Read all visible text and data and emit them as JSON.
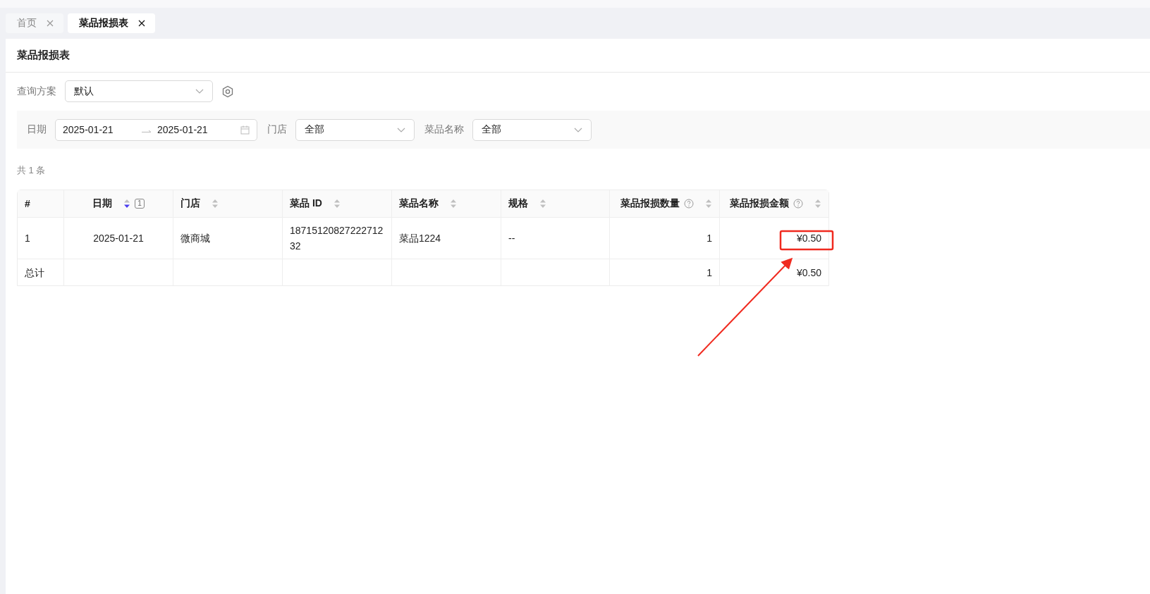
{
  "tabs": [
    {
      "label": "首页",
      "selected": false
    },
    {
      "label": "菜品报损表",
      "selected": true
    }
  ],
  "page": {
    "title": "菜品报损表"
  },
  "query_scheme": {
    "label": "查询方案",
    "value": "默认"
  },
  "filters": {
    "date": {
      "label": "日期",
      "start": "2025-01-21",
      "end": "2025-01-21"
    },
    "store": {
      "label": "门店",
      "value": "全部"
    },
    "dish_name": {
      "label": "菜品名称",
      "value": "全部"
    }
  },
  "total_count": "共 1 条",
  "table": {
    "columns": [
      {
        "label": "#",
        "kind": "index",
        "sortable": false,
        "help": false
      },
      {
        "label": "日期",
        "kind": "date",
        "sortable": true,
        "sort_desc": true,
        "sort_order": "1",
        "help": false
      },
      {
        "label": "门店",
        "kind": "text",
        "sortable": true,
        "sort_desc": false,
        "help": false
      },
      {
        "label": "菜品 ID",
        "kind": "text",
        "sortable": true,
        "sort_desc": false,
        "help": false
      },
      {
        "label": "菜品名称",
        "kind": "text",
        "sortable": true,
        "sort_desc": false,
        "help": false
      },
      {
        "label": "规格",
        "kind": "text",
        "sortable": true,
        "sort_desc": false,
        "help": false
      },
      {
        "label": "菜品报损数量",
        "kind": "number",
        "sortable": true,
        "sort_desc": false,
        "help": true
      },
      {
        "label": "菜品报损金额",
        "kind": "number",
        "sortable": true,
        "sort_desc": false,
        "help": true
      }
    ],
    "rows": [
      [
        "1",
        "2025-01-21",
        "微商城",
        "1871512082722271232",
        "菜品1224",
        "--",
        "1",
        "¥0.50"
      ]
    ],
    "summary": {
      "label": "总计",
      "loss_quantity": "1",
      "loss_amount": "¥0.50"
    }
  }
}
